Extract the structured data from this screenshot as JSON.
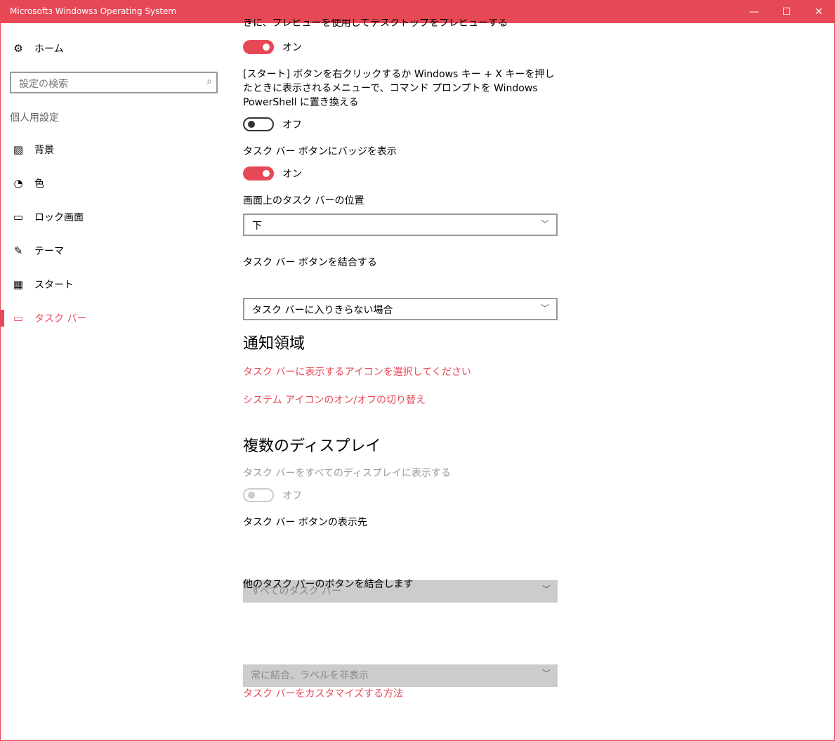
{
  "window": {
    "title": "Microsoft\u0003 Windows\u0003 Operating System",
    "title_display": "Microsoftз Windowsз Operating System"
  },
  "sidebar": {
    "home": "ホーム",
    "search_placeholder": "設定の検索",
    "section": "個人用設定",
    "items": [
      {
        "label": "背景",
        "icon": "picture-icon"
      },
      {
        "label": "色",
        "icon": "palette-icon"
      },
      {
        "label": "ロック画面",
        "icon": "lock-screen-icon"
      },
      {
        "label": "テーマ",
        "icon": "theme-icon"
      },
      {
        "label": "スタート",
        "icon": "start-icon"
      },
      {
        "label": "タスク バー",
        "icon": "taskbar-icon",
        "active": true
      }
    ]
  },
  "main": {
    "peek_label": "きに、プレビューを使用してデスクトップをプレビューする",
    "peek_state": "オン",
    "powershell_label": "[スタート] ボタンを右クリックするか Windows キー + X キーを押したときに表示されるメニューで、コマンド プロンプトを Windows PowerShell に置き換える",
    "powershell_state": "オフ",
    "badge_label": "タスク バー ボタンにバッジを表示",
    "badge_state": "オン",
    "position_label": "画面上のタスク バーの位置",
    "position_value": "下",
    "combine_label": "タスク バー ボタンを結合する",
    "combine_value": "タスク バーに入りきらない場合",
    "notify_heading": "通知領域",
    "notify_link1": "タスク バーに表示するアイコンを選択してください",
    "notify_link2": "システム アイコンのオン/オフの切り替え",
    "multi_heading": "複数のディスプレイ",
    "multi_show_label": "タスク バーをすべてのディスプレイに表示する",
    "multi_show_state": "オフ",
    "multi_buttons_label": "タスク バー ボタンの表示先",
    "multi_buttons_value": "すべてのタスク バー",
    "multi_combine_label": "他のタスク バーのボタンを結合します",
    "multi_combine_value": "常に結合、ラベルを非表示",
    "help_link": "タスク バーをカスタマイズする方法"
  },
  "colors": {
    "accent": "#e74856"
  }
}
